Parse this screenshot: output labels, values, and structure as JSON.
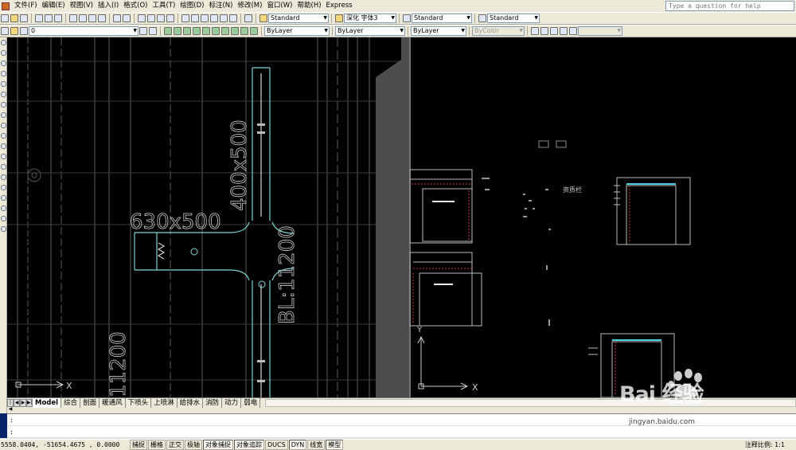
{
  "menubar": {
    "items": [
      "文件(F)",
      "编辑(E)",
      "视图(V)",
      "插入(I)",
      "格式(O)",
      "工具(T)",
      "绘图(D)",
      "标注(N)",
      "修改(M)",
      "窗口(W)",
      "帮助(H)",
      "Express"
    ],
    "help_placeholder": "Type a question for help"
  },
  "toolbar1": {
    "text_style": "Standard",
    "font_style": "深化 字体3",
    "dim_style": "Standard",
    "table_style": "Standard"
  },
  "toolbar2": {
    "layer": "0",
    "color": "ByLayer",
    "linetype": "ByLayer",
    "lineweight": "ByLayer",
    "plotstyle": "ByColor"
  },
  "drawing": {
    "dim_630": "630x500",
    "dim_400": "400x500",
    "bl_label": "BL:11200",
    "elev_left": "11200",
    "axis_x": "X",
    "axis_y": "Y",
    "sheet_label": "资质栏"
  },
  "tabs": [
    "Model",
    "综合",
    "剖面",
    "暖通风",
    "下喷头",
    "上喷淋",
    "给排水",
    "消防",
    "动力",
    "弱电"
  ],
  "command": {
    "line1": ":",
    "line2": ":"
  },
  "status": {
    "coords": "5558.0404,  -51654.4675 , 0.0000",
    "buttons": [
      "捕捉",
      "栅格",
      "正交",
      "极轴",
      "对象捕捉",
      "对象追踪",
      "DUCS",
      "DYN",
      "线宽",
      "模型"
    ],
    "scale_label": "注释比例: 1:1"
  },
  "watermark": {
    "brand": "Bai  经验",
    "url": "jingyan.baidu.com"
  },
  "colors": {
    "canvas": "#000000",
    "duct": "#7fd6d6",
    "grid": "#808080",
    "toolbar": "#ece9d8"
  }
}
